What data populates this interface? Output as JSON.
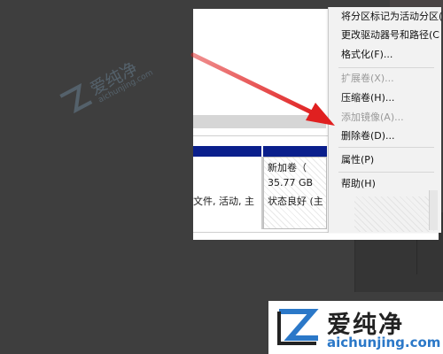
{
  "menu": {
    "items": [
      {
        "label": "将分区标记为活动分区(",
        "disabled": false
      },
      {
        "label": "更改驱动器号和路径(C",
        "disabled": false
      },
      {
        "label": "格式化(F)...",
        "disabled": false
      },
      {
        "label": "扩展卷(X)...",
        "disabled": true
      },
      {
        "label": "压缩卷(H)...",
        "disabled": false
      },
      {
        "label": "添加镜像(A)...",
        "disabled": true
      },
      {
        "label": "删除卷(D)...",
        "disabled": false
      },
      {
        "label": "属性(P)",
        "disabled": false
      },
      {
        "label": "帮助(H)",
        "disabled": false
      }
    ]
  },
  "partition": {
    "name": "新加卷（",
    "size": "35.77 GB",
    "status": "状态良好 (主"
  },
  "left_partition": {
    "status": "文件, 活动, 主"
  },
  "watermark": {
    "text": "爱纯净",
    "sub": "aichunjing.com"
  },
  "logo": {
    "text": "爱纯净",
    "url": "aichunjing.com"
  },
  "colors": {
    "arrow": "#e02020",
    "volume_bar": "#0a1f8c",
    "logo_accent": "#2b78c8",
    "background": "#3e3e3e"
  }
}
